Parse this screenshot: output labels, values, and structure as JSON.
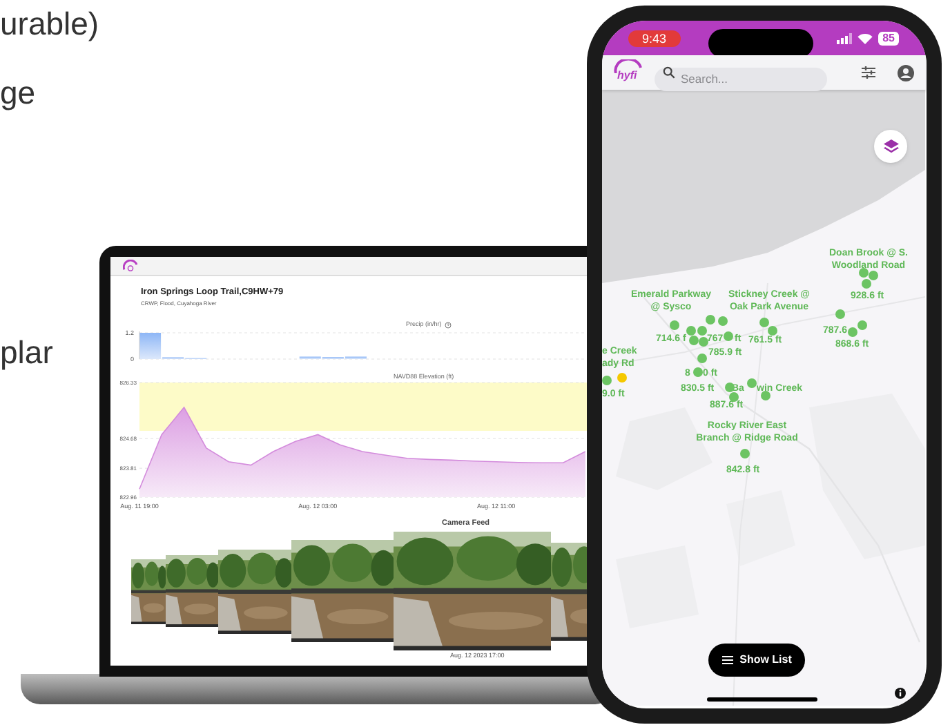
{
  "slide_text": [
    "urable)",
    "ge",
    "plar"
  ],
  "laptop": {
    "title": "Iron Springs Loop Trail,C9HW+79",
    "subtitle": "CRWP, Flood, Cuyahoga River",
    "precip_chart": {
      "chart_data": {
        "type": "bar",
        "title": "Precip (in/hr)",
        "ylim": [
          0,
          1.2
        ],
        "yticks": [
          0,
          1.2
        ],
        "values": [
          1.2,
          0.08,
          0.04,
          0,
          0,
          0,
          0,
          0.11,
          0.09,
          0.11,
          0,
          0,
          0,
          0,
          0,
          0,
          0,
          0,
          0,
          0
        ]
      }
    },
    "elevation_chart": {
      "chart_data": {
        "type": "area",
        "title": "NAVD88 Elevation (ft)",
        "ylim": [
          822.96,
          826.33
        ],
        "categories": [
          "Aug. 11 19:00",
          null,
          null,
          null,
          null,
          null,
          null,
          null,
          "Aug. 12 03:00",
          null,
          null,
          null,
          null,
          null,
          null,
          null,
          "Aug. 12 11:00",
          null,
          null,
          null,
          null
        ],
        "values": [
          823.2,
          824.8,
          825.6,
          824.4,
          824.0,
          823.9,
          824.3,
          824.6,
          824.8,
          824.5,
          824.3,
          824.2,
          824.1,
          824.07,
          824.05,
          824.02,
          824.0,
          823.98,
          823.97,
          823.97,
          824.3
        ],
        "yticks": [
          822.96,
          823.81,
          824.68,
          826.33
        ],
        "bands": [
          {
            "axis": "y",
            "from": 824.91,
            "to": 826.33,
            "color": "#fdfbc8"
          }
        ]
      }
    },
    "camera_feed": {
      "title": "Camera Feed",
      "caption": "Aug. 12 2023 17:00"
    }
  },
  "phone": {
    "time": "9:43",
    "battery": "85",
    "logo_text": "hyfi",
    "search": {
      "placeholder": "Search..."
    },
    "map_labels": [
      {
        "lines": [
          "Doan Brook @ S.",
          "Woodland Road"
        ]
      },
      {
        "lines": [
          "Emerald Parkway",
          "@ Sysco"
        ]
      },
      {
        "lines": [
          "Stickney Creek @",
          "Oak Park Avenue"
        ]
      },
      {
        "lines": [
          "928.6 ft"
        ]
      },
      {
        "lines": [
          "787.6"
        ]
      },
      {
        "lines": [
          "714.6 f"
        ]
      },
      {
        "lines": [
          "767"
        ]
      },
      {
        "lines": [
          "ft"
        ]
      },
      {
        "lines": [
          "761.5 ft"
        ]
      },
      {
        "lines": [
          "868.6 ft"
        ]
      },
      {
        "lines": [
          "e Creek",
          "ady Rd"
        ]
      },
      {
        "lines": [
          "785.9 ft"
        ]
      },
      {
        "lines": [
          "8"
        ]
      },
      {
        "lines": [
          "0 ft"
        ]
      },
      {
        "lines": [
          "830.5 ft"
        ]
      },
      {
        "lines": [
          "Ba"
        ]
      },
      {
        "lines": [
          "win Creek"
        ]
      },
      {
        "lines": [
          "9.0 ft"
        ]
      },
      {
        "lines": [
          "887.6 ft"
        ]
      },
      {
        "lines": [
          "Rocky River East",
          "Branch @ Ridge Road"
        ]
      },
      {
        "lines": [
          "842.8 ft"
        ]
      }
    ],
    "markers": [
      {
        "color": "#6cc463"
      },
      {
        "color": "#6cc463"
      },
      {
        "color": "#6cc463"
      },
      {
        "color": "#6cc463"
      },
      {
        "color": "#6cc463"
      },
      {
        "color": "#6cc463"
      },
      {
        "color": "#6cc463"
      },
      {
        "color": "#6cc463"
      },
      {
        "color": "#6cc463"
      },
      {
        "color": "#6cc463"
      },
      {
        "color": "#6cc463"
      },
      {
        "color": "#6cc463"
      },
      {
        "color": "#6cc463"
      },
      {
        "color": "#6cc463"
      },
      {
        "color": "#6cc463"
      },
      {
        "color": "#6cc463"
      },
      {
        "color": "#6cc463"
      },
      {
        "color": "#6cc463"
      },
      {
        "color": "#6cc463"
      },
      {
        "color": "#6cc463"
      },
      {
        "color": "#6cc463"
      },
      {
        "color": "#6cc463"
      },
      {
        "color": "#6cc463"
      },
      {
        "color": "#6cc463"
      },
      {
        "color": "#f5c800"
      }
    ],
    "show_list_button": "Show List"
  }
}
